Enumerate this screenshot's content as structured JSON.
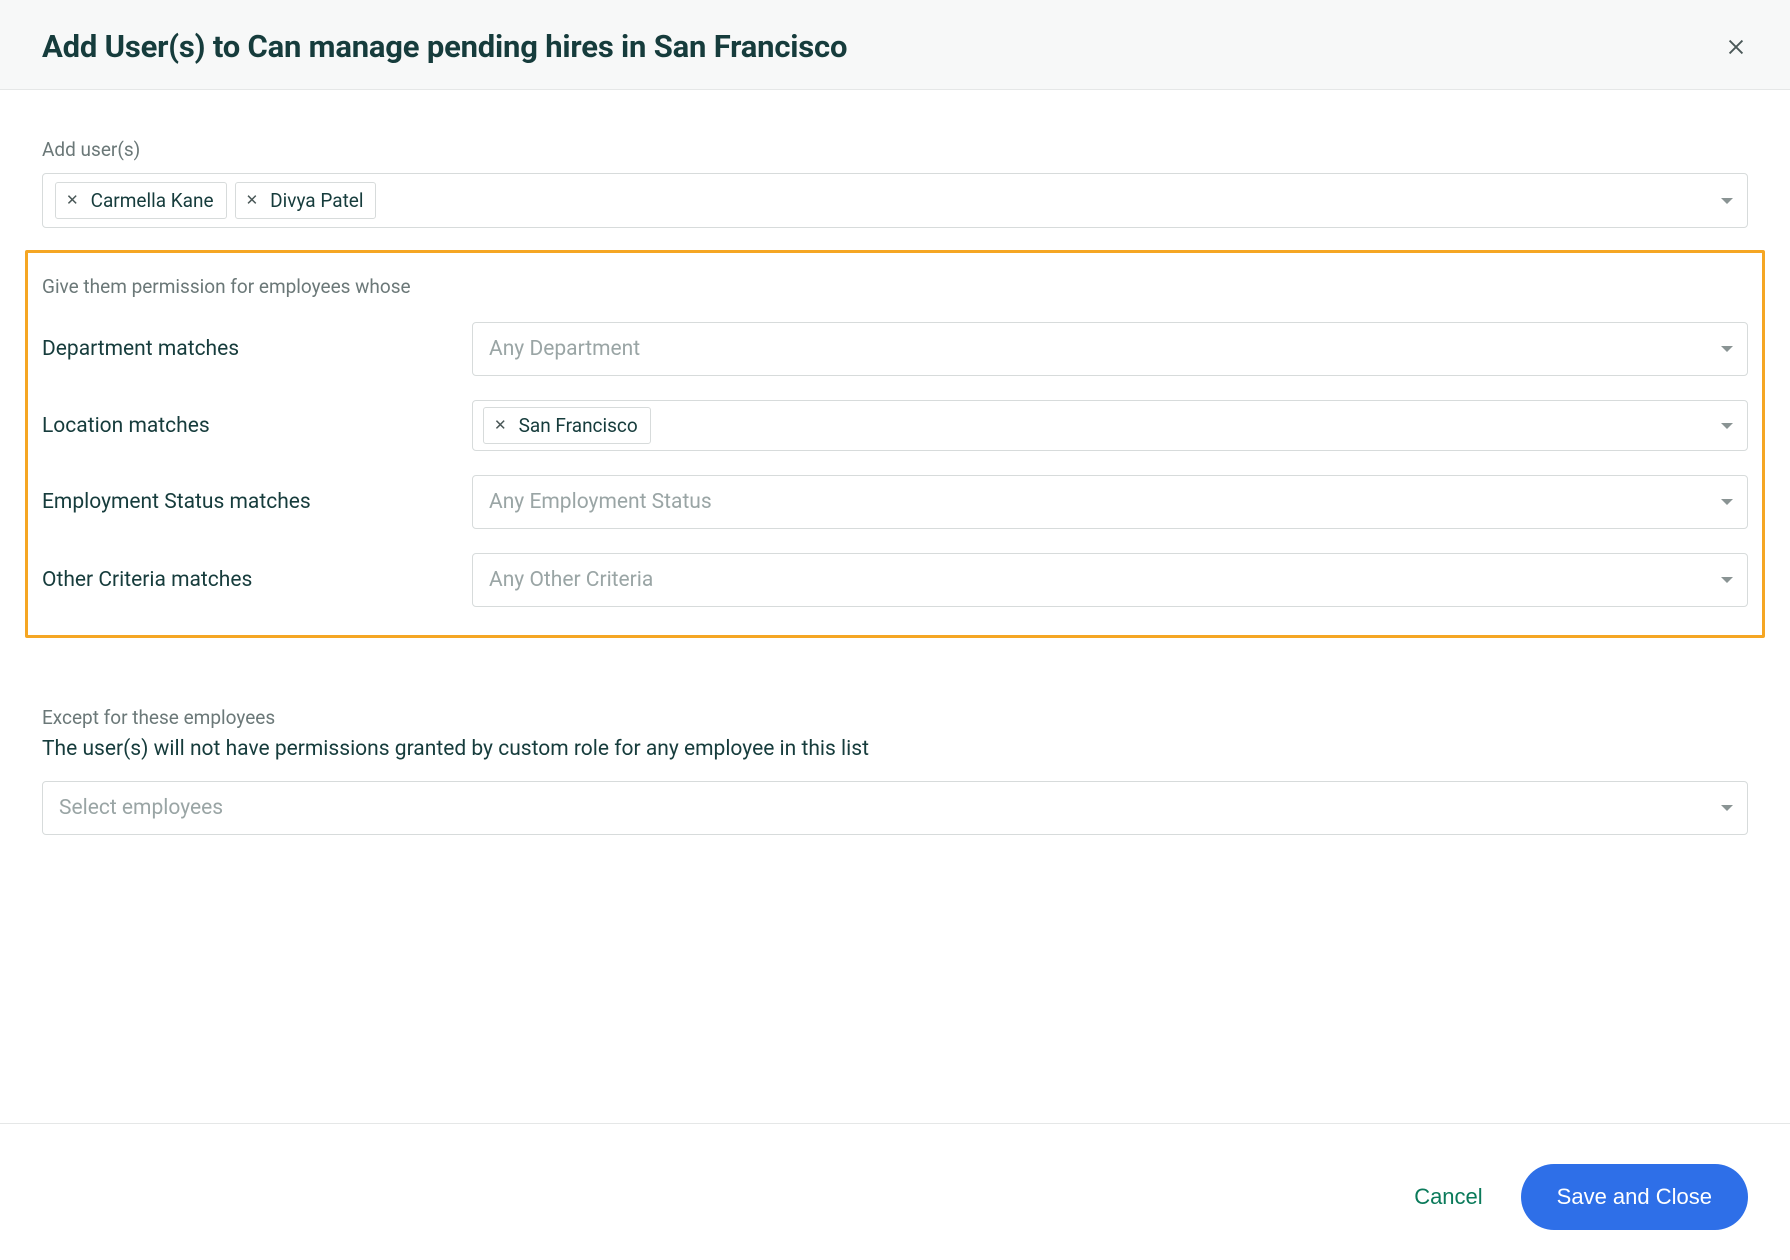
{
  "header": {
    "title": "Add User(s) to Can manage pending hires in San Francisco"
  },
  "addUsers": {
    "label": "Add user(s)",
    "chips": [
      "Carmella Kane",
      "Divya Patel"
    ]
  },
  "criteria": {
    "heading": "Give them permission for employees whose",
    "rows": [
      {
        "label": "Department matches",
        "placeholder": "Any Department",
        "chips": []
      },
      {
        "label": "Location matches",
        "placeholder": "",
        "chips": [
          "San Francisco"
        ]
      },
      {
        "label": "Employment Status matches",
        "placeholder": "Any Employment Status",
        "chips": []
      },
      {
        "label": "Other Criteria matches",
        "placeholder": "Any Other Criteria",
        "chips": []
      }
    ]
  },
  "except": {
    "heading": "Except for these employees",
    "description": "The user(s) will not have permissions granted by custom role for any employee in this list",
    "placeholder": "Select employees"
  },
  "footer": {
    "cancel": "Cancel",
    "save": "Save and Close"
  }
}
